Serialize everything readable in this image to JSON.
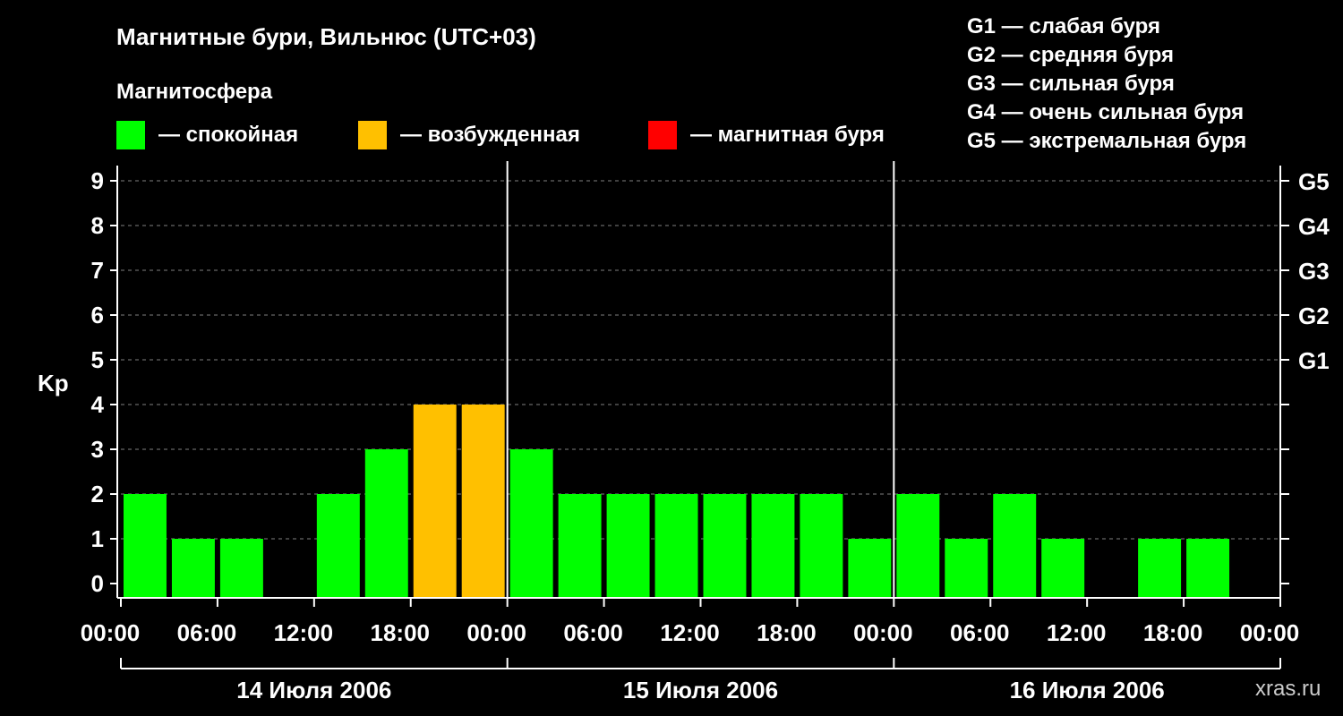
{
  "chart_data": {
    "type": "bar",
    "title": "Магнитные бури, Вильнюс (UTC+03)",
    "legend": {
      "title": "Магнитосфера",
      "placement": "top",
      "items": [
        {
          "label": "— спокойная",
          "color": "#00FF00"
        },
        {
          "label": "— возбужденная",
          "color": "#FFC000"
        },
        {
          "label": "— магнитная буря",
          "color": "#FF0000"
        }
      ]
    },
    "storm_scale": [
      "G1 — слабая буря",
      "G2 — средняя буря",
      "G3 — сильная буря",
      "G4 — очень сильная буря",
      "G5 — экстремальная буря"
    ],
    "ylabel": "Kp",
    "ylim": [
      0,
      9
    ],
    "yticks": [
      "0",
      "1",
      "2",
      "3",
      "4",
      "5",
      "6",
      "7",
      "8",
      "9"
    ],
    "right_ticks": [
      {
        "y": 5,
        "label": "G1"
      },
      {
        "y": 6,
        "label": "G2"
      },
      {
        "y": 7,
        "label": "G3"
      },
      {
        "y": 8,
        "label": "G4"
      },
      {
        "y": 9,
        "label": "G5"
      }
    ],
    "xticks": [
      "00:00",
      "06:00",
      "12:00",
      "18:00",
      "00:00",
      "06:00",
      "12:00",
      "18:00",
      "00:00",
      "06:00",
      "12:00",
      "18:00",
      "00:00"
    ],
    "days": [
      "14 Июля 2006",
      "15 Июля 2006",
      "16 Июля 2006"
    ],
    "interval_hours": 3,
    "grid": true,
    "values": [
      2,
      1,
      1,
      0,
      2,
      3,
      4,
      4,
      3,
      2,
      2,
      2,
      2,
      2,
      2,
      1,
      2,
      1,
      2,
      1,
      0,
      1,
      1,
      0
    ],
    "colors": {
      "quiet": "#00FF00",
      "active": "#FFC000",
      "storm": "#FF0000",
      "background": "#000000",
      "axis": "#FFFFFF",
      "grid": "#808080"
    },
    "watermark": "xras.ru"
  }
}
